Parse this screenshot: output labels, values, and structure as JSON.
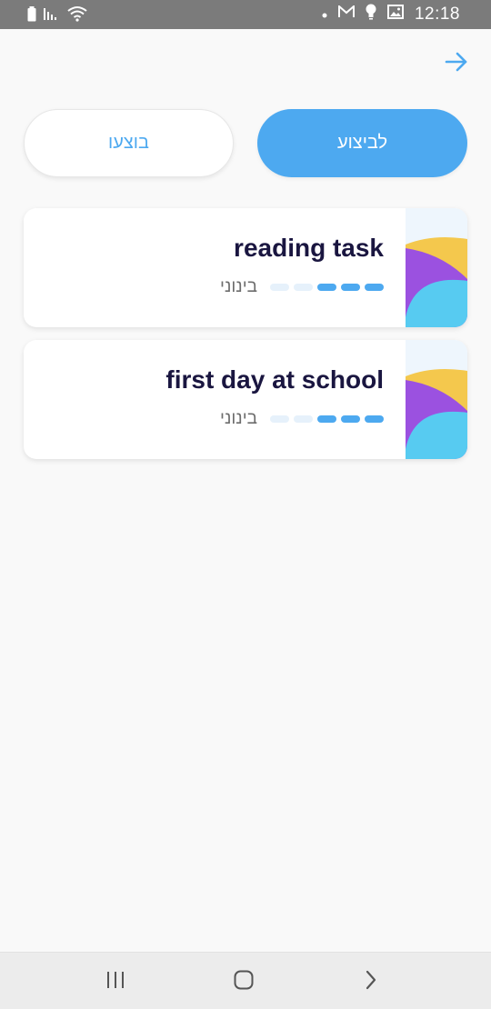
{
  "status_bar": {
    "time": "12:18",
    "icons_left": [
      "battery-icon",
      "signal-icon",
      "wifi-icon"
    ],
    "icons_right": [
      "notification-dot-icon",
      "gmail-icon",
      "bulb-icon",
      "gallery-icon"
    ]
  },
  "header": {
    "back_icon": "arrow-right-icon"
  },
  "tabs": {
    "active_label": "לביצוע",
    "inactive_label": "בוצעו"
  },
  "tasks": [
    {
      "title": "reading task",
      "level_label": "בינוני",
      "level_filled": 3,
      "level_total": 5
    },
    {
      "title": "first day at school",
      "level_label": "בינוני",
      "level_filled": 3,
      "level_total": 5
    }
  ],
  "colors": {
    "accent": "#4da9f0",
    "title": "#1a1640",
    "thumb_yellow": "#f4c84d",
    "thumb_purple": "#9b51e0",
    "thumb_cyan": "#57cbf1",
    "thumb_bg": "#eef6fd"
  },
  "nav_bar": {
    "icons": [
      "recents-icon",
      "home-icon",
      "back-chevron-icon"
    ]
  }
}
